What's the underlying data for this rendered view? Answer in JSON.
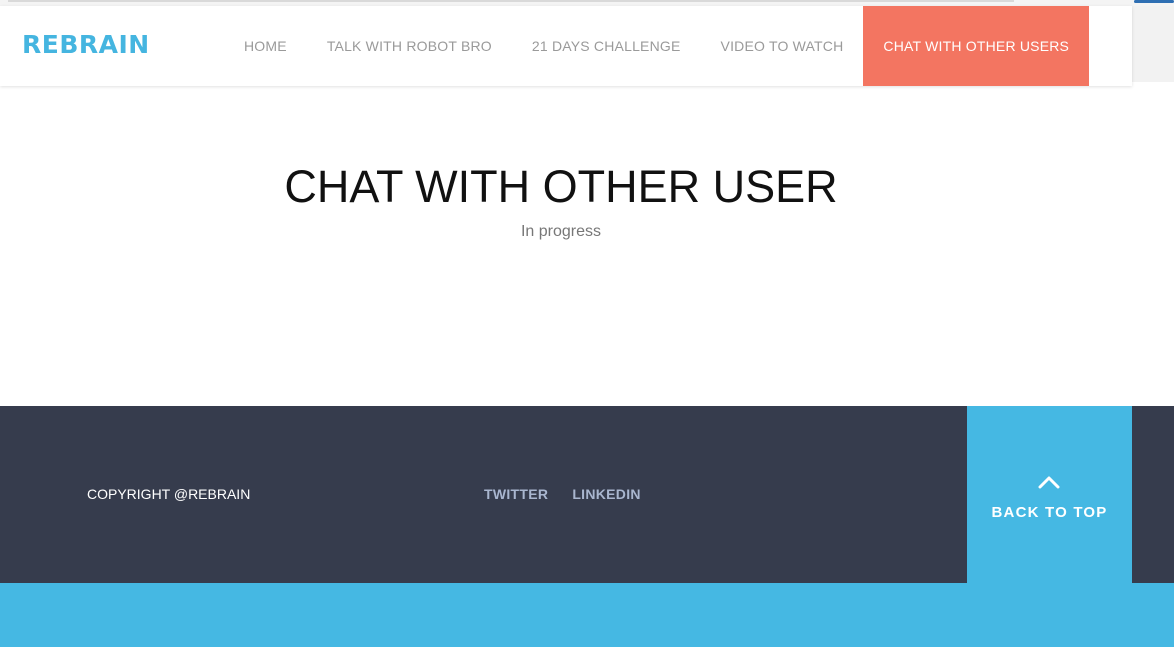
{
  "header": {
    "brand": "REBRAIN",
    "nav": [
      {
        "label": "HOME"
      },
      {
        "label": "TALK WITH ROBOT BRO"
      },
      {
        "label": "21 DAYS CHALLENGE"
      },
      {
        "label": "VIDEO TO WATCH"
      },
      {
        "label": "CHAT WITH OTHER USERS",
        "active": true
      }
    ]
  },
  "main": {
    "title": "CHAT WITH OTHER USER",
    "subtitle": "In progress"
  },
  "footer": {
    "copyright": "COPYRIGHT @REBRAIN",
    "social": [
      {
        "label": "TWITTER"
      },
      {
        "label": "LINKEDIN"
      }
    ],
    "back_to_top": {
      "label": "BACK TO TOP",
      "icon": "chevron-up-icon"
    }
  },
  "colors": {
    "brand": "#45b5e0",
    "active_nav": "#f37561",
    "footer_bg": "#363c4d",
    "accent_blue": "#45b8e3"
  }
}
